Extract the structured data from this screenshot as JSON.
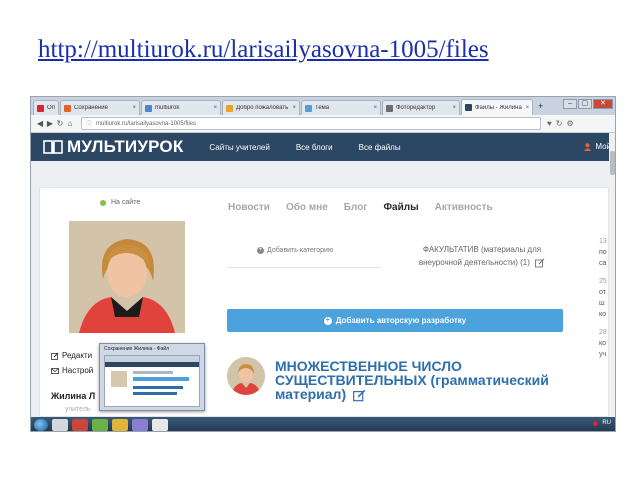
{
  "slide": {
    "link_text": "http://multiurok.ru/larisailyasovna-1005/files"
  },
  "browser": {
    "tabs": [
      {
        "label": "Опера",
        "color": "#d8262b",
        "active": false
      },
      {
        "label": "Сохранение",
        "color": "#e0652b",
        "active": false
      },
      {
        "label": "multiurok",
        "color": "#4a86c8",
        "active": false
      },
      {
        "label": "Добро пожаловать",
        "color": "#e6a52a",
        "active": false
      },
      {
        "label": "Тема",
        "color": "#5b9bd5",
        "active": false
      },
      {
        "label": "Фоторедактор",
        "color": "#6d6d6d",
        "active": false
      },
      {
        "label": "Файлы - Жилина Лариса",
        "color": "#2b4763",
        "active": true
      }
    ],
    "new_tab_label": "+",
    "address": "multiurok.ru/larisailyasovna-1005/files",
    "window_controls": [
      "–",
      "▢",
      "✕"
    ]
  },
  "site": {
    "logo_text": "МУЛЬТИУРОК",
    "menu": [
      "Сайты учителей",
      "Все блоги",
      "Все файлы"
    ],
    "user_link": "Мой",
    "brand_color": "#2b4763",
    "accent_color": "#4ba2dc"
  },
  "profile": {
    "status": "На сайте",
    "links": [
      "Редакти",
      "Настрой"
    ],
    "name": "Жилина Л",
    "subtitle": "учитель"
  },
  "tabs": [
    {
      "label": "Новости",
      "active": false
    },
    {
      "label": "Обо мне",
      "active": false
    },
    {
      "label": "Блог",
      "active": false
    },
    {
      "label": "Файлы",
      "active": true
    },
    {
      "label": "Активность",
      "active": false
    }
  ],
  "files": {
    "add_category": "Добавить категорию",
    "category": "ФАКУЛЬТАТИВ (материалы для внеурочной деятельности) (1)",
    "add_button": "Добавить авторскую разработку",
    "material_title": "МНОЖЕСТВЕННОЕ ЧИСЛО СУЩЕСТВИТЕЛЬНЫХ (грамматический материал)"
  },
  "right_column": [
    {
      "num": "13",
      "text": "по"
    },
    {
      "num": "",
      "text": "са"
    },
    {
      "num": "25",
      "text": "от"
    },
    {
      "num": "",
      "text": "ш"
    },
    {
      "num": "",
      "text": "ко"
    },
    {
      "num": "28",
      "text": "ко"
    },
    {
      "num": "",
      "text": "уч"
    }
  ],
  "taskbar": {
    "icons": [
      "#d4d8dc",
      "#c9463b",
      "#6cb04a",
      "#e0b43a",
      "#8a7ed0",
      "#e8e8e8"
    ],
    "tray_text": "RU"
  },
  "popup": {
    "title": "Сохранение Жилина - Файл"
  }
}
